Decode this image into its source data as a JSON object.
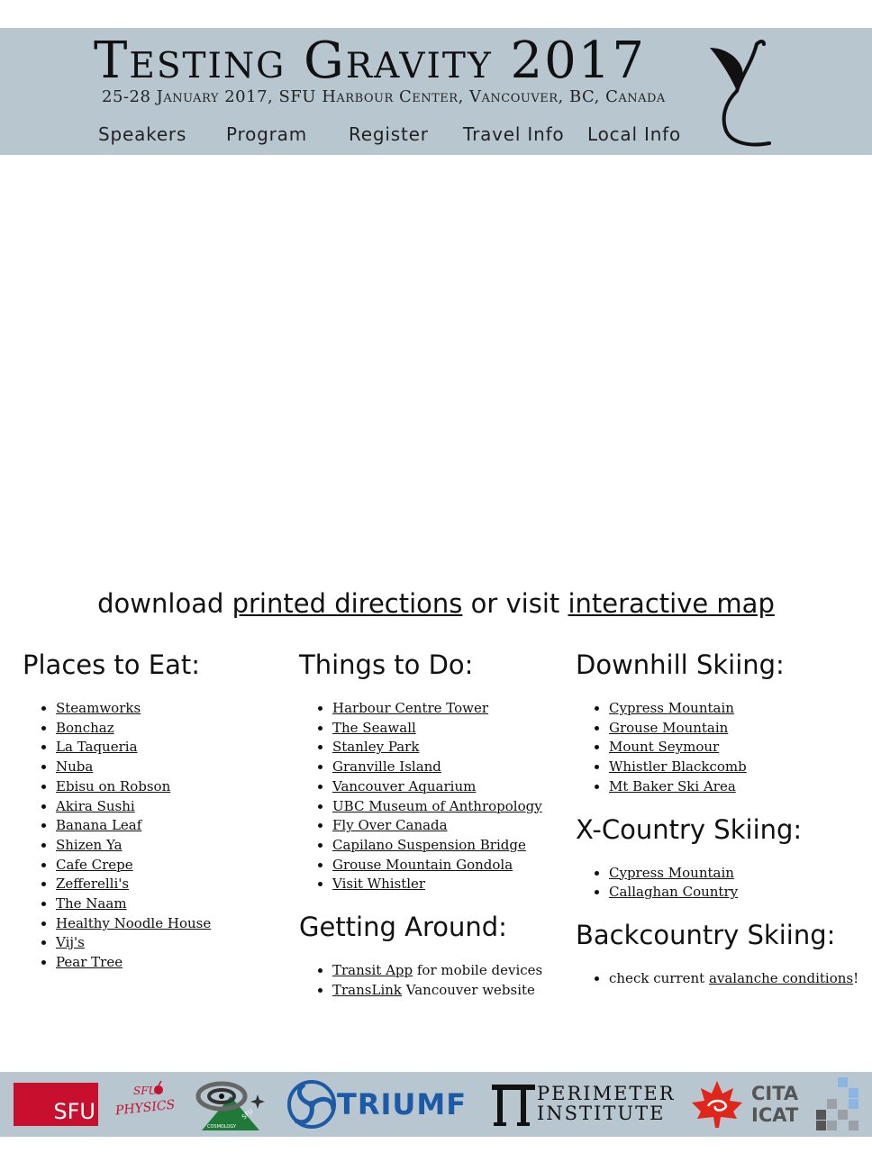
{
  "header": {
    "title": "Testing Gravity 2017",
    "subtitle": "25-28 January 2017, SFU Harbour Center, Vancouver, BC, Canada",
    "nav": [
      "Speakers",
      "Program",
      "Register",
      "Travel Info",
      "Local Info"
    ],
    "logo_icon": "sprout-logo-icon",
    "background_color": "#b8c7cf"
  },
  "directions": {
    "prefix": "download ",
    "printed_link": "printed directions",
    "middle": " or visit ",
    "map_link": "interactive map"
  },
  "places_to_eat": {
    "heading": "Places to Eat:",
    "items": [
      "Steamworks",
      "Bonchaz",
      "La Taqueria",
      "Nuba",
      "Ebisu on Robson",
      "Akira Sushi",
      "Banana Leaf",
      "Shizen Ya",
      "Cafe Crepe",
      "Zefferelli's",
      "The Naam",
      "Healthy Noodle House",
      "Vij's",
      "Pear Tree"
    ]
  },
  "things_to_do": {
    "heading": "Things to Do:",
    "items": [
      "Harbour Centre Tower",
      "The Seawall",
      "Stanley Park",
      "Granville Island",
      "Vancouver Aquarium",
      "UBC Museum of Anthropology",
      "Fly Over Canada",
      "Capilano Suspension Bridge",
      "Grouse Mountain Gondola",
      "Visit Whistler"
    ]
  },
  "getting_around": {
    "heading": "Getting Around:",
    "items": [
      {
        "link": "Transit App",
        "suffix": " for mobile devices"
      },
      {
        "link": "TransLink",
        "suffix": " Vancouver website"
      }
    ]
  },
  "downhill_skiing": {
    "heading": "Downhill Skiing:",
    "items": [
      "Cypress Mountain",
      "Grouse Mountain",
      "Mount Seymour",
      "Whistler Blackcomb",
      "Mt Baker Ski Area"
    ]
  },
  "xcountry_skiing": {
    "heading": "X-Country Skiing:",
    "items": [
      "Cypress Mountain",
      "Callaghan Country"
    ]
  },
  "backcountry_skiing": {
    "heading": "Backcountry Skiing:",
    "prefix": "check current ",
    "link": "avalanche conditions",
    "suffix": "!"
  },
  "sponsors": {
    "sfu": "SFU",
    "sfu_physics": [
      "SFU",
      "PHYSICS"
    ],
    "cosmology": [
      "SFU",
      "COSMOLOGY"
    ],
    "triumf": "TRIUMF",
    "perimeter": [
      "PERIMETER",
      "INSTITUTE"
    ],
    "cita": [
      "CITA",
      "ICAT"
    ],
    "colors": {
      "sfu_red": "#c8102e",
      "triumf_blue": "#1c5aa8",
      "cita_red": "#e1251b",
      "cosmology_green": "#1f7a3a"
    }
  }
}
